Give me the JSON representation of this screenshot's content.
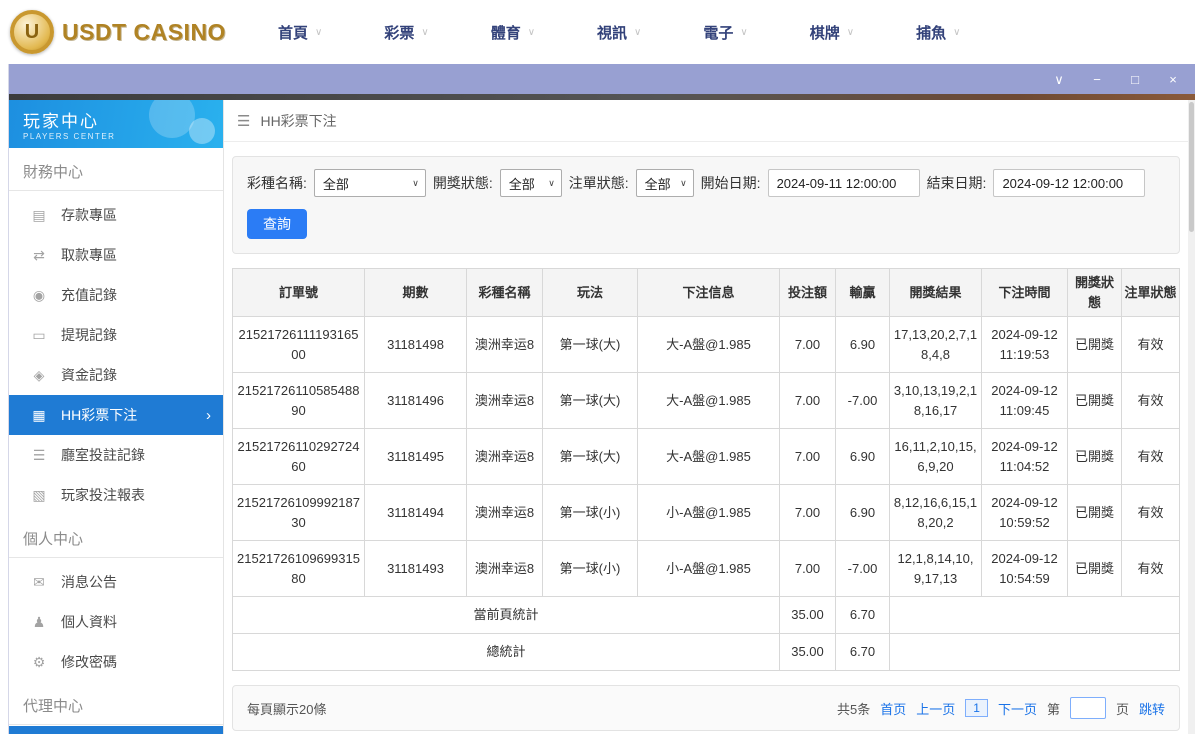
{
  "site_header": {
    "logo_text": "USDT CASINO",
    "logo_letter": "U",
    "chevron": "∨",
    "nav_items": [
      {
        "label": "首頁"
      },
      {
        "label": "彩票"
      },
      {
        "label": "體育"
      },
      {
        "label": "視訊"
      },
      {
        "label": "電子"
      },
      {
        "label": "棋牌"
      },
      {
        "label": "捕魚"
      }
    ]
  },
  "window": {
    "controls": {
      "chevron": "∨",
      "minimize": "−",
      "maximize": "□",
      "close": "×"
    }
  },
  "sidebar": {
    "title": "玩家中心",
    "subtitle": "PLAYERS CENTER",
    "sections": [
      {
        "label": "財務中心",
        "items": [
          {
            "label": "存款專區",
            "icon": "▤"
          },
          {
            "label": "取款專區",
            "icon": "⇄"
          },
          {
            "label": "充值記錄",
            "icon": "◉"
          },
          {
            "label": "提現記錄",
            "icon": "▭"
          },
          {
            "label": "資金記錄",
            "icon": "◈"
          },
          {
            "label": "HH彩票下注",
            "icon": "▦",
            "arrow": "›"
          },
          {
            "label": "廳室投註記錄",
            "icon": "☰"
          },
          {
            "label": "玩家投注報表",
            "icon": "▧"
          }
        ]
      },
      {
        "label": "個人中心",
        "items": [
          {
            "label": "消息公告",
            "icon": "✉"
          },
          {
            "label": "個人資料",
            "icon": "♟"
          },
          {
            "label": "修改密碼",
            "icon": "⚙"
          }
        ]
      },
      {
        "label": "代理中心",
        "items": []
      }
    ]
  },
  "main": {
    "breadcrumb": {
      "menu_icon": "☰",
      "title": "HH彩票下注"
    },
    "filters": {
      "lottery_label": "彩種名稱:",
      "lottery_value": "全部",
      "draw_status_label": "開獎狀態:",
      "draw_status_value": "全部",
      "order_status_label": "注單狀態:",
      "order_status_value": "全部",
      "start_label": "開始日期:",
      "start_value": "2024-09-11 12:00:00",
      "end_label": "結束日期:",
      "end_value": "2024-09-12 12:00:00",
      "search_button": "查詢",
      "select_arrow": "∨"
    },
    "table": {
      "headers": [
        "訂單號",
        "期數",
        "彩種名稱",
        "玩法",
        "下注信息",
        "投注額",
        "輸贏",
        "開獎結果",
        "下注時間",
        "開獎狀態",
        "注單狀態"
      ],
      "rows": [
        {
          "order_id": "2152172611119316500",
          "period": "31181498",
          "lottery": "澳洲幸运8",
          "play": "第一球(大)",
          "bet_info": "大-A盤@1.985",
          "amount": "7.00",
          "win_loss": "6.90",
          "result": "17,13,20,2,7,18,4,8",
          "time": "2024-09-12 11:19:53",
          "draw_status": "已開獎",
          "order_status": "有效"
        },
        {
          "order_id": "2152172611058548890",
          "period": "31181496",
          "lottery": "澳洲幸运8",
          "play": "第一球(大)",
          "bet_info": "大-A盤@1.985",
          "amount": "7.00",
          "win_loss": "-7.00",
          "result": "3,10,13,19,2,18,16,17",
          "time": "2024-09-12 11:09:45",
          "draw_status": "已開獎",
          "order_status": "有效"
        },
        {
          "order_id": "2152172611029272460",
          "period": "31181495",
          "lottery": "澳洲幸运8",
          "play": "第一球(大)",
          "bet_info": "大-A盤@1.985",
          "amount": "7.00",
          "win_loss": "6.90",
          "result": "16,11,2,10,15,6,9,20",
          "time": "2024-09-12 11:04:52",
          "draw_status": "已開獎",
          "order_status": "有效"
        },
        {
          "order_id": "2152172610999218730",
          "period": "31181494",
          "lottery": "澳洲幸运8",
          "play": "第一球(小)",
          "bet_info": "小-A盤@1.985",
          "amount": "7.00",
          "win_loss": "6.90",
          "result": "8,12,16,6,15,18,20,2",
          "time": "2024-09-12 10:59:52",
          "draw_status": "已開獎",
          "order_status": "有效"
        },
        {
          "order_id": "2152172610969931580",
          "period": "31181493",
          "lottery": "澳洲幸运8",
          "play": "第一球(小)",
          "bet_info": "小-A盤@1.985",
          "amount": "7.00",
          "win_loss": "-7.00",
          "result": "12,1,8,14,10,9,17,13",
          "time": "2024-09-12 10:54:59",
          "draw_status": "已開獎",
          "order_status": "有效"
        }
      ],
      "summary": [
        {
          "label": "當前頁統計",
          "amount": "35.00",
          "win_loss": "6.70"
        },
        {
          "label": "總統計",
          "amount": "35.00",
          "win_loss": "6.70"
        }
      ]
    },
    "pagination": {
      "page_size_text": "每頁顯示20條",
      "total_text": "共5条",
      "first": "首页",
      "prev": "上一页",
      "current": "1",
      "next": "下一页",
      "jump_pre": "第",
      "jump_post": "页",
      "jump_button": "跳转"
    }
  }
}
